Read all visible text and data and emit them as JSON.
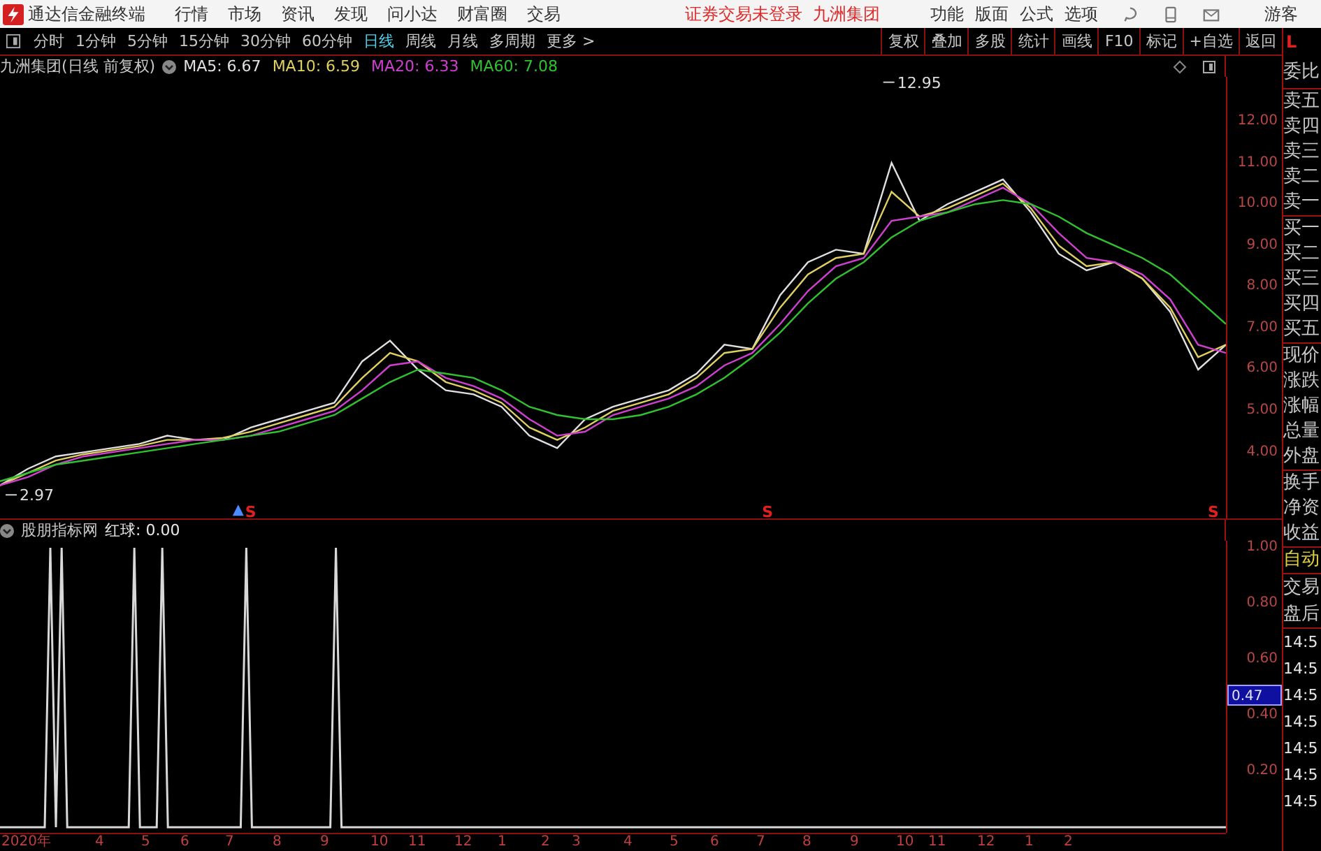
{
  "title_bar": {
    "app_name": "通达信金融终端",
    "menu": [
      "行情",
      "市场",
      "资讯",
      "发现",
      "问小达",
      "财富圈",
      "交易"
    ],
    "notice": "证券交易未登录  九洲集团",
    "right_menu": [
      "功能",
      "版面",
      "公式",
      "选项"
    ],
    "user": "游客"
  },
  "toolbar": {
    "periods": [
      {
        "label": "分时",
        "selected": false
      },
      {
        "label": "1分钟",
        "selected": false
      },
      {
        "label": "5分钟",
        "selected": false
      },
      {
        "label": "15分钟",
        "selected": false
      },
      {
        "label": "30分钟",
        "selected": false
      },
      {
        "label": "60分钟",
        "selected": false
      },
      {
        "label": "日线",
        "selected": true
      },
      {
        "label": "周线",
        "selected": false
      },
      {
        "label": "月线",
        "selected": false
      },
      {
        "label": "多周期",
        "selected": false
      },
      {
        "label": "更多 >",
        "selected": false
      }
    ],
    "buttons": [
      "复权",
      "叠加",
      "多股",
      "统计",
      "画线",
      "F10",
      "标记",
      "+自选",
      "返回"
    ]
  },
  "price_panel": {
    "legend": {
      "title": "九洲集团(日线 前复权)",
      "values": [
        ": 6.67",
        ": 6.59",
        ": 6.33",
        ": 7.08"
      ]
    },
    "marks": {
      "high": "12.95",
      "low": "2.97",
      "signals": [
        "S",
        "S",
        "S"
      ]
    },
    "chart_data": {
      "type": "line",
      "ylim": [
        2.4,
        13.08
      ],
      "yticks": [
        {
          "value": 4,
          "label": "4.00"
        },
        {
          "value": 5,
          "label": "5.00"
        },
        {
          "value": 6,
          "label": "6.00"
        },
        {
          "value": 7,
          "label": "7.00"
        },
        {
          "value": 8,
          "label": "8.00"
        },
        {
          "value": 9,
          "label": "9.00"
        },
        {
          "value": 10,
          "label": "10.00"
        },
        {
          "value": 11,
          "label": "11.00"
        },
        {
          "value": 12,
          "label": "12.00"
        }
      ],
      "series": [
        {
          "name": "MA5",
          "color": "#e0e0e0",
          "values": [
            3.2,
            3.6,
            3.9,
            4.0,
            4.1,
            4.2,
            4.4,
            4.3,
            4.3,
            4.6,
            4.8,
            5.0,
            5.2,
            6.2,
            6.7,
            6.0,
            5.5,
            5.4,
            5.1,
            4.4,
            4.1,
            4.8,
            5.1,
            5.3,
            5.5,
            5.9,
            6.6,
            6.5,
            7.8,
            8.6,
            8.9,
            8.8,
            11.0,
            9.6,
            10.0,
            10.3,
            10.6,
            9.8,
            8.8,
            8.4,
            8.6,
            8.2,
            7.4,
            6.0,
            6.6
          ]
        },
        {
          "name": "MA10",
          "color": "#e0d060",
          "values": [
            3.2,
            3.5,
            3.8,
            3.95,
            4.05,
            4.15,
            4.3,
            4.3,
            4.35,
            4.5,
            4.7,
            4.9,
            5.1,
            5.8,
            6.4,
            6.2,
            5.7,
            5.5,
            5.2,
            4.6,
            4.3,
            4.6,
            5.0,
            5.2,
            5.4,
            5.8,
            6.4,
            6.5,
            7.5,
            8.3,
            8.7,
            8.8,
            10.3,
            9.7,
            9.9,
            10.2,
            10.5,
            9.9,
            9.0,
            8.5,
            8.6,
            8.2,
            7.5,
            6.3,
            6.6
          ]
        },
        {
          "name": "MA20",
          "color": "#d040d0",
          "values": [
            3.2,
            3.4,
            3.7,
            3.9,
            4.0,
            4.1,
            4.2,
            4.3,
            4.3,
            4.4,
            4.6,
            4.8,
            5.0,
            5.5,
            6.1,
            6.2,
            5.8,
            5.6,
            5.3,
            4.8,
            4.4,
            4.5,
            4.9,
            5.1,
            5.3,
            5.6,
            6.1,
            6.4,
            7.1,
            7.9,
            8.5,
            8.7,
            9.6,
            9.7,
            9.8,
            10.1,
            10.4,
            10.0,
            9.3,
            8.7,
            8.6,
            8.3,
            7.7,
            6.6,
            6.4
          ]
        },
        {
          "name": "MA60",
          "color": "#30c030",
          "values": [
            3.3,
            3.5,
            3.7,
            3.8,
            3.9,
            4.0,
            4.1,
            4.2,
            4.3,
            4.4,
            4.5,
            4.7,
            4.9,
            5.3,
            5.7,
            6.0,
            5.9,
            5.8,
            5.5,
            5.1,
            4.9,
            4.8,
            4.8,
            4.9,
            5.1,
            5.4,
            5.8,
            6.3,
            6.9,
            7.6,
            8.2,
            8.6,
            9.2,
            9.6,
            9.8,
            10.0,
            10.1,
            10.0,
            9.7,
            9.3,
            9.0,
            8.7,
            8.3,
            7.7,
            7.1
          ]
        }
      ]
    }
  },
  "indicator_panel": {
    "legend": {
      "title": "股朋指标网",
      "value": ": 0.00"
    },
    "cursor_value": "0.47",
    "x_axis": [
      "2020年",
      "4",
      "5",
      "6",
      "7",
      "8",
      "9",
      "10",
      "11",
      "12",
      "1",
      "2",
      "3",
      "4",
      "5",
      "6",
      "7",
      "8",
      "9",
      "10",
      "11",
      "12",
      "1",
      "2"
    ],
    "chart_data": {
      "type": "line",
      "ylim": [
        -0.02,
        1.025
      ],
      "categories": [
        null,
        null,
        null,
        null,
        null,
        null,
        null,
        null,
        null,
        null,
        null,
        null,
        null,
        null,
        null,
        null,
        null,
        null,
        null,
        null,
        null,
        null,
        null,
        null,
        null,
        null,
        null,
        null,
        null,
        null,
        null,
        null,
        null,
        null,
        null,
        null,
        null,
        null,
        null,
        null,
        null,
        null,
        null,
        null,
        null,
        null,
        null,
        null,
        null,
        null,
        null,
        null,
        null,
        null,
        null,
        null,
        null,
        null,
        null,
        null,
        null,
        null,
        null,
        null,
        null,
        null,
        null,
        null,
        null,
        null,
        null,
        null,
        null,
        null,
        null,
        null,
        null,
        null,
        null,
        null,
        null,
        null,
        null,
        null,
        null,
        null,
        null,
        null,
        null,
        null,
        null,
        null,
        null,
        null,
        null,
        null,
        null,
        null,
        null,
        null,
        null,
        null,
        null,
        null,
        null,
        null,
        null,
        null,
        null,
        null,
        null,
        null,
        null,
        null,
        null,
        null,
        null,
        null,
        null,
        null,
        null,
        null,
        null,
        null,
        null,
        null,
        null,
        null,
        null,
        null,
        null,
        null,
        null,
        null,
        null,
        null,
        null,
        null,
        null,
        null,
        null,
        null,
        null,
        null,
        null,
        null,
        null,
        null,
        null,
        null,
        null,
        null,
        null,
        null,
        null,
        null,
        null,
        null,
        null,
        null,
        null,
        null,
        null,
        null,
        null,
        null,
        null,
        null,
        null,
        null,
        null,
        null,
        null,
        null,
        null,
        null,
        null,
        null,
        null,
        null,
        null,
        null,
        null,
        null,
        null,
        null,
        null,
        null,
        null,
        null,
        null,
        null,
        null,
        null,
        null,
        null,
        null,
        null,
        null,
        null,
        null,
        null,
        null,
        null,
        null,
        null,
        null,
        null,
        null,
        null,
        null,
        null,
        null,
        null,
        null,
        null,
        null,
        null,
        null,
        null
      ],
      "series": [
        {
          "name": "红球",
          "color": "#d8d8d8",
          "values": [
            0,
            0,
            0,
            0,
            0,
            0,
            0,
            0,
            0,
            1,
            0,
            1,
            0,
            0,
            0,
            0,
            0,
            0,
            0,
            0,
            0,
            0,
            0,
            0,
            1,
            0,
            0,
            0,
            0,
            1,
            0,
            0,
            0,
            0,
            0,
            0,
            0,
            0,
            0,
            0,
            0,
            0,
            0,
            0,
            1,
            0,
            0,
            0,
            0,
            0,
            0,
            0,
            0,
            0,
            0,
            0,
            0,
            0,
            0,
            0,
            1,
            0,
            0,
            0,
            0,
            0,
            0,
            0,
            0,
            0,
            0,
            0,
            0,
            0,
            0,
            0,
            0,
            0,
            0,
            0,
            0,
            0,
            0,
            0,
            0,
            0,
            0,
            0,
            0,
            0,
            0,
            0,
            0,
            0,
            0,
            0,
            0,
            0,
            0,
            0,
            0,
            0,
            0,
            0,
            0,
            0,
            0,
            0,
            0,
            0,
            0,
            0,
            0,
            0,
            0,
            0,
            0,
            0,
            0,
            0,
            0,
            0,
            0,
            0,
            0,
            0,
            0,
            0,
            0,
            0,
            0,
            0,
            0,
            0,
            0,
            0,
            0,
            0,
            0,
            0,
            0,
            0,
            0,
            0,
            0,
            0,
            0,
            0,
            0,
            0,
            0,
            0,
            0,
            0,
            0,
            0,
            0,
            0,
            0,
            0,
            0,
            0,
            0,
            0,
            0,
            0,
            0,
            0,
            0,
            0,
            0,
            0,
            0,
            0,
            0,
            0,
            0,
            0,
            0,
            0,
            0,
            0,
            0,
            0,
            0,
            0,
            0,
            0,
            0,
            0,
            0,
            0,
            0,
            0,
            0,
            0,
            0,
            0,
            0,
            0,
            0,
            0,
            0,
            0,
            0,
            0,
            0,
            0,
            0,
            0,
            0,
            0,
            0,
            0,
            0,
            0,
            0,
            0,
            0,
            0
          ]
        }
      ],
      "yticks": [
        {
          "value": 0.2,
          "label": "0.20"
        },
        {
          "value": 0.4,
          "label": "0.40"
        },
        {
          "value": 0.6,
          "label": "0.60"
        },
        {
          "value": 0.8,
          "label": "0.80"
        },
        {
          "value": 1,
          "label": "1.00"
        }
      ]
    }
  },
  "quote_panel": {
    "corner": "L",
    "header": "委比",
    "sections": [
      [
        "卖五",
        "卖四",
        "卖三",
        "卖二",
        "卖一"
      ],
      [
        "买一",
        "买二",
        "买三",
        "买四",
        "买五"
      ],
      [
        "现价",
        "涨跌",
        "涨幅",
        "总量",
        "外盘"
      ],
      [
        "换手",
        "净资",
        "收益"
      ]
    ],
    "mode": "自动",
    "tabs": [
      "交易",
      "盘后"
    ],
    "times": [
      "14:5",
      "14:5",
      "14:5",
      "14:5",
      "14:5",
      "14:5",
      "14:5"
    ]
  }
}
